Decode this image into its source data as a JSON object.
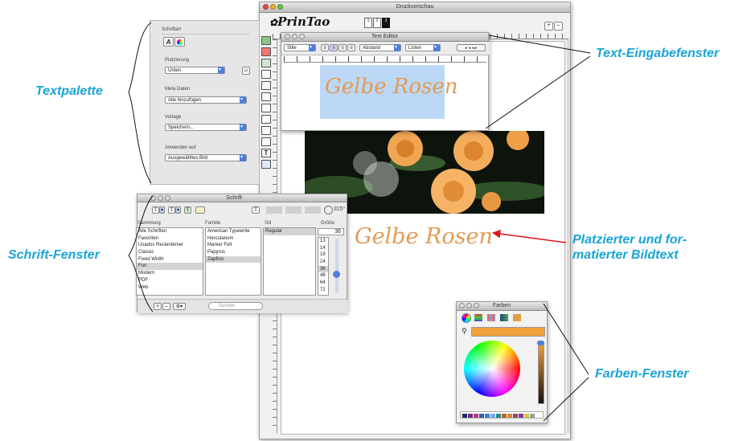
{
  "main_window": {
    "title": "Druckvorschau",
    "logo": "PrinTao",
    "page_indicators": [
      "1",
      "2",
      "3"
    ],
    "caption_text": "Gelbe Rosen"
  },
  "text_palette": {
    "font_section": "Schriftart",
    "placement_label": "Platzierung",
    "placement_value": "Unten",
    "meta_label": "Meta Daten",
    "meta_value": "Alle hinzufügen",
    "template_label": "Vorlage",
    "template_value": "Speichern...",
    "apply_label": "Anwenden auf",
    "apply_value": "Ausgewähltes Bild"
  },
  "text_editor": {
    "title": "Text Editor",
    "style_popup": "Stile",
    "spacing_popup": "Abstand",
    "lists_popup": "Listen",
    "text": "Gelbe Rosen"
  },
  "font_window": {
    "title": "Schrift",
    "rotation": "315°",
    "col_collection": "Sammlung",
    "col_family": "Familie",
    "col_style": "Stil",
    "col_size": "Größe",
    "collections": [
      "Alle Schriften",
      "Favoriten",
      "Usados Recientemer",
      "Classic",
      "Fixed Width",
      "Fun",
      "Modern",
      "PDF",
      "Web"
    ],
    "families": [
      "American Typewrite",
      "Herculanum",
      "Marker Felt",
      "Papyrus",
      "Zapfino"
    ],
    "styles": [
      "Regular"
    ],
    "size_value": "36",
    "sizes": [
      "13",
      "14",
      "18",
      "24",
      "36",
      "48",
      "64",
      "72"
    ],
    "search_placeholder": "Suchen",
    "add": "+",
    "remove": "–"
  },
  "colors_window": {
    "title": "Farben",
    "current_color": "#f2a23a",
    "swatches": [
      "#1f2a6b",
      "#6b2a8a",
      "#c03a7a",
      "#2a5fb0",
      "#3f7ed6",
      "#7aa9e6",
      "#1f8a8a",
      "#c06020",
      "#d08a30",
      "#a04060",
      "#7a3aa0",
      "#e0c040",
      "#9aa0a6"
    ]
  },
  "callouts": {
    "textpalette": "Textpalette",
    "text_input": "Text-Eingabefenster",
    "font_window": "Schrift-Fenster",
    "placed_text_line1": "Platzierter und for-",
    "placed_text_line2": "matierter Bildtext",
    "colors_window": "Farben-Fenster"
  },
  "colors": {
    "callout": "#1aa4d6",
    "arrow": "#e0141e",
    "caption": "#e39a55",
    "editor_highlight": "#bcd8f6",
    "accent_blue": "#4f7fd8"
  }
}
